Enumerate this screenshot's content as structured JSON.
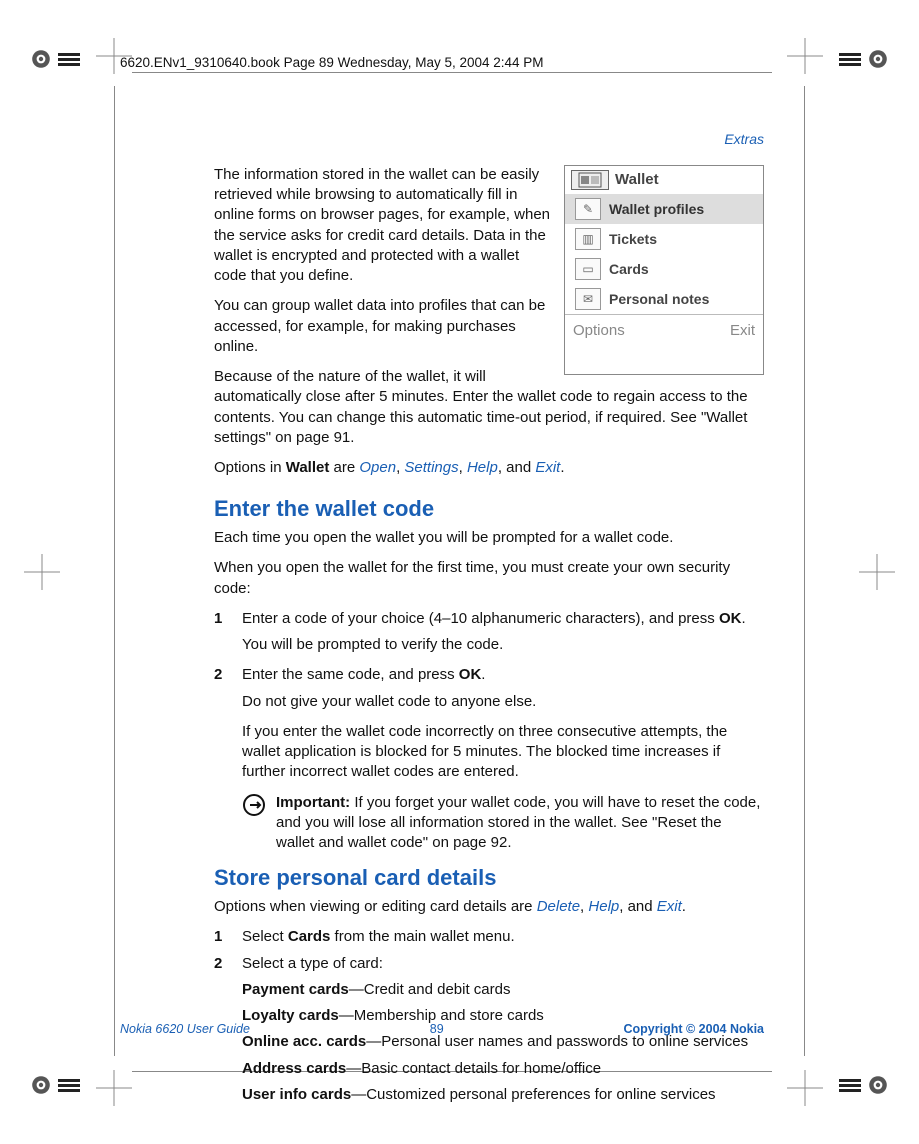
{
  "meta_line": "6620.ENv1_9310640.book  Page 89  Wednesday, May 5, 2004  2:44 PM",
  "header_link": "Extras",
  "intro": {
    "p1": "The information stored in the wallet can be easily retrieved while browsing to automatically fill in online forms on browser pages, for example, when the service asks for credit card details. Data in the wallet is encrypted and protected with a wallet code that you define.",
    "p2": "You can group wallet data into profiles that can be accessed, for example, for making purchases online.",
    "p3": "Because of the nature of the wallet, it will automatically close after 5 minutes. Enter the wallet code to regain access to the contents. You can change this automatic time-out period, if required. See \"Wallet settings\" on page 91."
  },
  "options_line": {
    "pre": "Options in ",
    "wallet": "Wallet",
    "mid": " are ",
    "o1": "Open",
    "o2": "Settings",
    "o3": "Help",
    "o4": "Exit"
  },
  "screenshot": {
    "title": "Wallet",
    "items": [
      {
        "label": "Wallet profiles",
        "selected": true
      },
      {
        "label": "Tickets",
        "selected": false
      },
      {
        "label": "Cards",
        "selected": false
      },
      {
        "label": "Personal notes",
        "selected": false
      }
    ],
    "soft_left": "Options",
    "soft_right": "Exit"
  },
  "section1": {
    "heading": "Enter the wallet code",
    "p1": "Each time you open the wallet you will be prompted for a wallet code.",
    "p2": "When you open the wallet for the first time, you must create your own security code:",
    "step1_pre": "Enter a code of your choice (4–10 alphanumeric characters), and press ",
    "step1_bold": "OK",
    "step1_post": ".",
    "step1_cont": "You will be prompted to verify the code.",
    "step2_pre": "Enter the same code, and press ",
    "step2_bold": "OK",
    "step2_post": ".",
    "step2_cont1": "Do not give your wallet code to anyone else.",
    "step2_cont2": "If you enter the wallet code incorrectly on three consecutive attempts, the wallet application is blocked for 5 minutes. The blocked time increases if further incorrect wallet codes are entered.",
    "important_label": "Important:",
    "important_text": " If you forget your wallet code, you will have to reset the code, and you will lose all information stored in the wallet. See \"Reset the wallet and wallet code\" on page 92."
  },
  "section2": {
    "heading": "Store personal card details",
    "options_pre": "Options when viewing or editing card details are ",
    "o1": "Delete",
    "o2": "Help",
    "o3": "Exit",
    "step1_pre": "Select ",
    "step1_bold": "Cards",
    "step1_post": " from the main wallet menu.",
    "step2": "Select a type of card:",
    "cards": [
      {
        "name": "Payment cards",
        "desc": "—Credit and debit cards"
      },
      {
        "name": "Loyalty cards",
        "desc": "—Membership and store cards"
      },
      {
        "name": "Online acc. cards",
        "desc": "—Personal user names and passwords to online services"
      },
      {
        "name": "Address cards",
        "desc": "—Basic contact details for home/office"
      },
      {
        "name": "User info cards",
        "desc": "—Customized personal preferences for online services"
      }
    ]
  },
  "footer": {
    "left": "Nokia 6620 User Guide",
    "center": "89",
    "right": "Copyright © 2004 Nokia"
  },
  "numbers": {
    "n1": "1",
    "n2": "2"
  }
}
